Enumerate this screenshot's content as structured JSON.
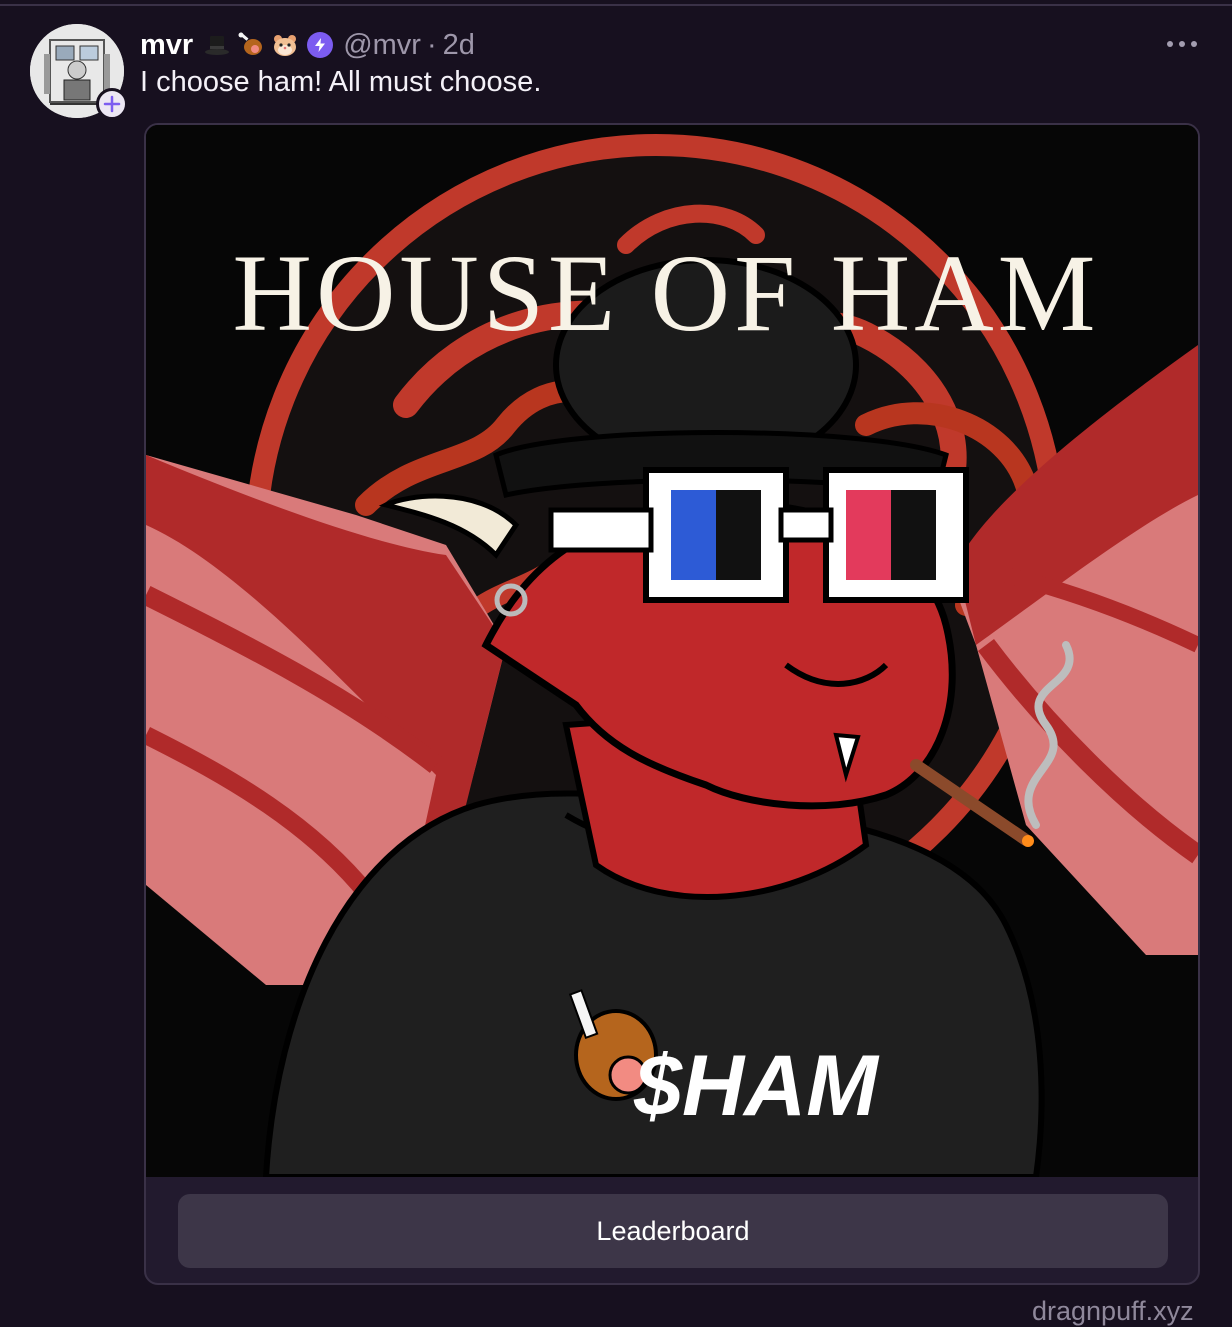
{
  "post": {
    "author": {
      "display_name": "mvr",
      "handle": "@mvr",
      "badges": [
        "top-hat-icon",
        "meat-on-bone-icon",
        "hamster-icon"
      ],
      "power_badge": "lightning-badge-icon"
    },
    "separator": "·",
    "timestamp": "2d",
    "text": "I choose ham! All must choose.",
    "menu_icon": "more-horizontal-icon",
    "follow_icon": "plus-icon"
  },
  "embed": {
    "image": {
      "title_text": "HOUSE OF HAM",
      "shirt_text": "$HAM"
    },
    "button_label": "Leaderboard",
    "domain": "dragnpuff.xyz"
  },
  "colors": {
    "background": "#17101f",
    "accent": "#7c5cf0",
    "muted_text": "#9e97aa",
    "button_bg": "#3d3648"
  }
}
